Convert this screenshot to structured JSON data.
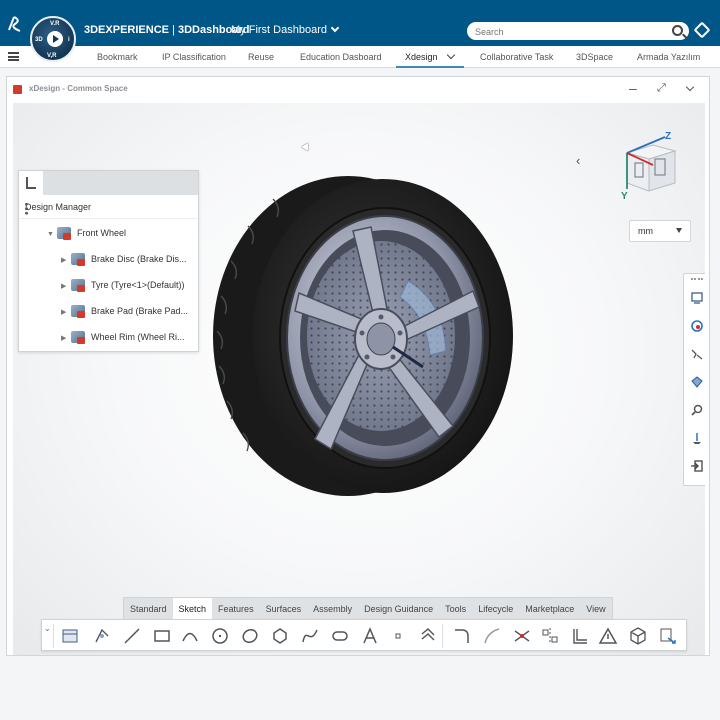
{
  "topbar": {
    "brand_bold": "3DEXPERIENCE",
    "brand_sep": " | ",
    "brand_app": "3DDashboard",
    "dashboard_name": "My First Dashboard",
    "search_placeholder": "Search",
    "compass_labels": {
      "top": "V.R",
      "left": "3D",
      "right": "i",
      "bottom": "V,R"
    }
  },
  "tabs": [
    {
      "label": "Bookmark"
    },
    {
      "label": "IP Classification"
    },
    {
      "label": "Reuse"
    },
    {
      "label": "Education Dasboard"
    },
    {
      "label": "Xdesign",
      "active": true
    },
    {
      "label": "Collaborative Task"
    },
    {
      "label": "3DSpace"
    },
    {
      "label": "Armada Yazılım"
    }
  ],
  "widget": {
    "title": "xDesign - Common Space"
  },
  "design_manager": {
    "title": "Design Manager",
    "root": {
      "label": "Front Wheel"
    },
    "children": [
      {
        "label": "Brake Disc (Brake Dis..."
      },
      {
        "label": "Tyre (Tyre<1>(Default))"
      },
      {
        "label": "Brake Pad (Brake Pad..."
      },
      {
        "label": "Wheel Rim (Wheel Ri..."
      }
    ]
  },
  "viewcube": {
    "axis_z": "Z",
    "axis_y": "Y"
  },
  "units": {
    "value": "mm"
  },
  "action_bar": {
    "tabs": [
      {
        "label": "Standard"
      },
      {
        "label": "Sketch",
        "active": true
      },
      {
        "label": "Features"
      },
      {
        "label": "Surfaces"
      },
      {
        "label": "Assembly"
      },
      {
        "label": "Design Guidance"
      },
      {
        "label": "Tools"
      },
      {
        "label": "Lifecycle"
      },
      {
        "label": "Marketplace"
      },
      {
        "label": "View"
      }
    ],
    "tools": [
      "sketch-icon",
      "pattern-icon",
      "line-icon",
      "rectangle-icon",
      "arc-icon",
      "circle-icon",
      "ellipse-icon",
      "polygon-icon",
      "spline-icon",
      "slot-icon",
      "text-icon",
      "point-icon",
      "offset-icon",
      "fillet-icon",
      "chamfer-icon",
      "trim-icon",
      "mirror-icon",
      "constraint-icon",
      "warning-icon",
      "cube-icon",
      "dimension-icon"
    ]
  },
  "colors": {
    "topbar": "#005686",
    "accent": "#3d8ab9",
    "part_badge": "#d43a2a"
  }
}
